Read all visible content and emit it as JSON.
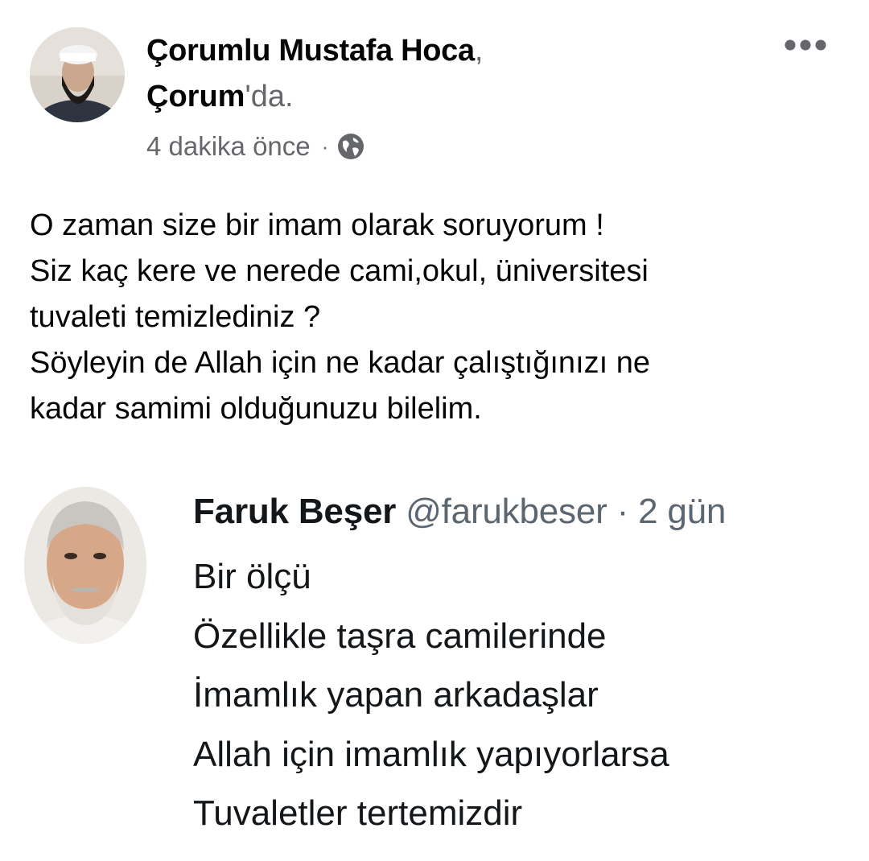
{
  "post": {
    "author": "Çorumlu Mustafa  Hoca",
    "author_separator": ",",
    "location": "Çorum",
    "location_suffix": "'da.",
    "time": "4 dakika önce",
    "meta_separator": "·",
    "privacy_icon": "globe-icon",
    "more_icon": "more-options-icon",
    "text_lines": [
      "O zaman size bir imam olarak soruyorum !",
      "Siz kaç kere ve nerede cami,okul, üniversitesi",
      "tuvaleti temizlediniz ?",
      "Söyleyin de Allah için ne kadar çalıştığınızı ne",
      "kadar samimi olduğunuzu bilelim."
    ]
  },
  "quoted_tweet": {
    "name": "Faruk Beşer",
    "handle": "@farukbeser",
    "separator": "·",
    "time": "2 gün",
    "lines": [
      "Bir ölçü",
      "Özellikle taşra camilerinde",
      "İmamlık yapan arkadaşlar",
      "Allah için imamlık yapıyorlarsa",
      "Tuvaletler tertemizdir"
    ]
  },
  "colors": {
    "text_primary": "#050505",
    "text_secondary": "#65676b",
    "tweet_handle": "#5b6670",
    "background": "#ffffff"
  }
}
